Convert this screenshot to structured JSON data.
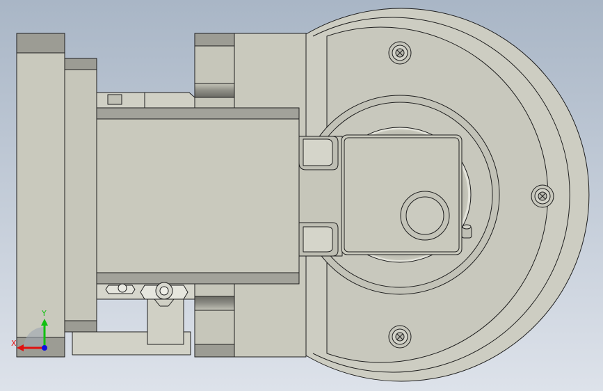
{
  "viewport": {
    "background_top": "#a9b6c6",
    "background_bottom": "#dde2ea"
  },
  "model": {
    "part_fill": "#c9c9bd",
    "part_shade": "#b6b6aa",
    "dark_band": "#8e8e86",
    "light_band": "#d8d8cd",
    "edge_color": "#1e1e1e",
    "screw_count": 3
  },
  "triad": {
    "x_label": "X",
    "y_label": "Y",
    "x_color": "#e01010",
    "y_color": "#10c010",
    "z_color": "#1010e0"
  }
}
